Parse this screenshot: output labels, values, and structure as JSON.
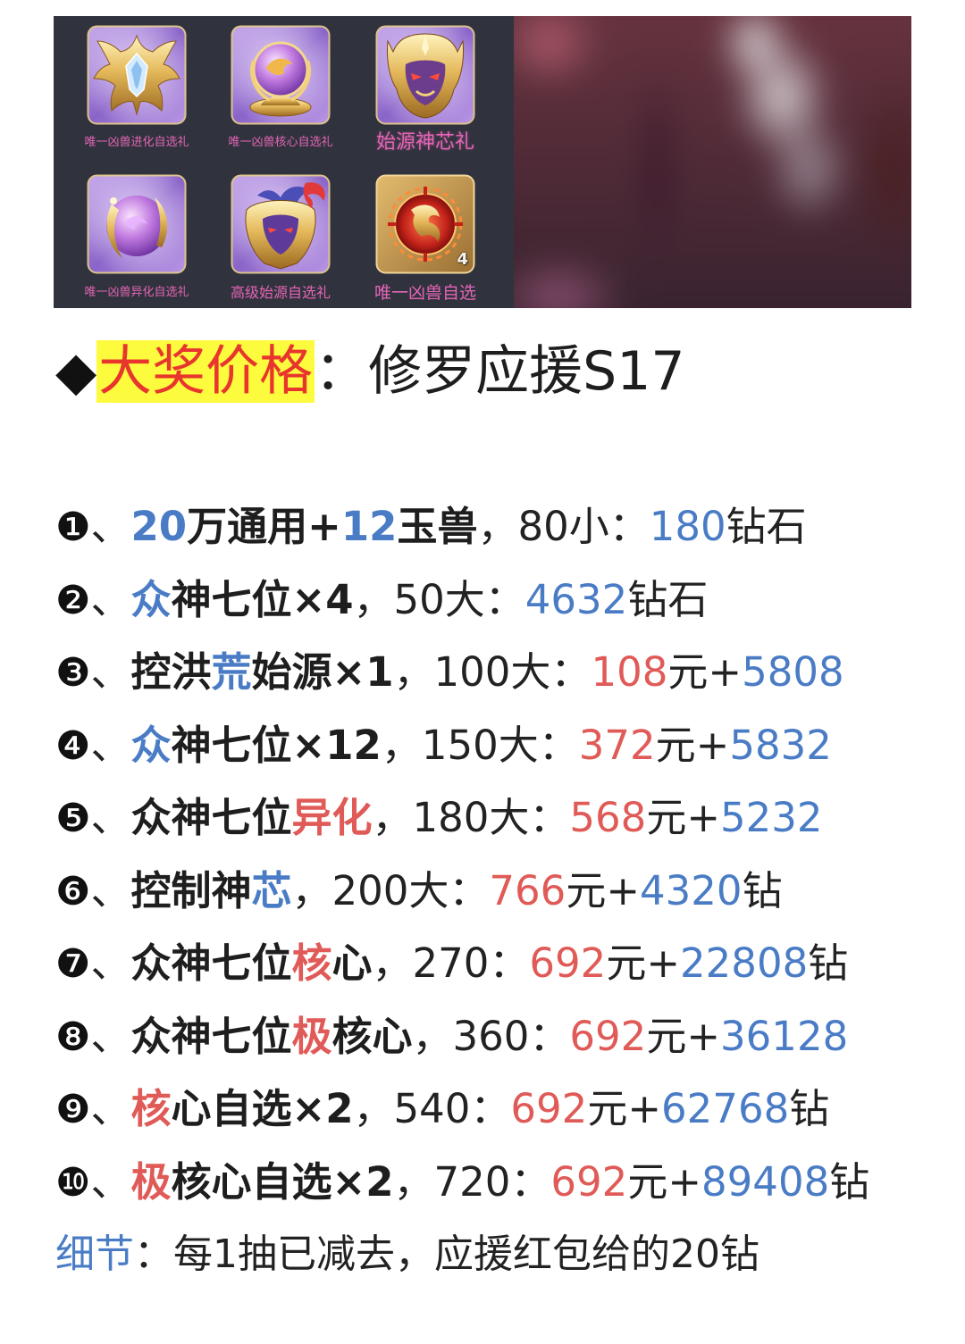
{
  "colors": {
    "blue": "#4a7cc6",
    "red": "#e05a57",
    "text": "#1e1e1e",
    "title_highlight_bg": "#fcfb3d",
    "title_highlight_text": "#e8352d",
    "item_label": "#e464b6",
    "item_panel_bg": "#30333d"
  },
  "hero": {
    "items": [
      {
        "label": "唯一凶兽进化自选礼",
        "icon": "winged-crest-icon"
      },
      {
        "label": "唯一凶兽核心自选礼",
        "icon": "golden-orb-icon"
      },
      {
        "label": "始源神芯礼",
        "icon": "demon-mask-icon"
      },
      {
        "label": "唯一凶兽异化自选礼",
        "icon": "purple-orb-icon"
      },
      {
        "label": "高级始源自选礼",
        "icon": "dragon-helmet-icon"
      },
      {
        "label": "唯一凶兽自选",
        "icon": "dragon-emblem-icon",
        "count": "4"
      }
    ]
  },
  "title": {
    "bullet": "◆",
    "highlight": "大奖价格",
    "rest": "：修罗应援S17"
  },
  "prizes": [
    {
      "num": "❶",
      "sep": "、",
      "name": [
        {
          "t": "20",
          "c": "blue"
        },
        {
          "t": "万通用+"
        },
        {
          "t": "12",
          "c": "blue"
        },
        {
          "t": "玉兽"
        }
      ],
      "draws": "，80小：",
      "price": [
        {
          "t": "180",
          "c": "blue"
        },
        {
          "t": "钻石"
        }
      ]
    },
    {
      "num": "❷",
      "sep": "、",
      "name": [
        {
          "t": "众",
          "c": "blue"
        },
        {
          "t": "神七位×4"
        }
      ],
      "draws": "，50大：",
      "price": [
        {
          "t": "4632",
          "c": "blue"
        },
        {
          "t": "钻石"
        }
      ]
    },
    {
      "num": "❸",
      "sep": "、",
      "name": [
        {
          "t": "控洪"
        },
        {
          "t": "荒",
          "c": "blue"
        },
        {
          "t": "始源×1"
        }
      ],
      "draws": "，100大：",
      "price": [
        {
          "t": "108",
          "c": "red"
        },
        {
          "t": "元+"
        },
        {
          "t": "5808",
          "c": "blue"
        }
      ]
    },
    {
      "num": "❹",
      "sep": "、",
      "name": [
        {
          "t": "众",
          "c": "blue"
        },
        {
          "t": "神七位×12"
        }
      ],
      "draws": "，150大：",
      "price": [
        {
          "t": "372",
          "c": "red"
        },
        {
          "t": "元+"
        },
        {
          "t": "5832",
          "c": "blue"
        }
      ]
    },
    {
      "num": "❺",
      "sep": "、",
      "name": [
        {
          "t": "众神七位"
        },
        {
          "t": "异化",
          "c": "red"
        }
      ],
      "draws": "，180大：",
      "price": [
        {
          "t": "568",
          "c": "red"
        },
        {
          "t": "元+"
        },
        {
          "t": "5232",
          "c": "blue"
        }
      ]
    },
    {
      "num": "❻",
      "sep": "、",
      "name": [
        {
          "t": "控制神"
        },
        {
          "t": "芯",
          "c": "blue"
        }
      ],
      "draws": "，200大：",
      "price": [
        {
          "t": "766",
          "c": "red"
        },
        {
          "t": "元+"
        },
        {
          "t": "4320",
          "c": "blue"
        },
        {
          "t": "钻"
        }
      ]
    },
    {
      "num": "❼",
      "sep": "、",
      "name": [
        {
          "t": "众神七位"
        },
        {
          "t": "核",
          "c": "red"
        },
        {
          "t": "心"
        }
      ],
      "draws": "，270：",
      "price": [
        {
          "t": "692",
          "c": "red"
        },
        {
          "t": "元+"
        },
        {
          "t": "22808",
          "c": "blue"
        },
        {
          "t": "钻"
        }
      ]
    },
    {
      "num": "❽",
      "sep": "、",
      "name": [
        {
          "t": "众神七位"
        },
        {
          "t": "极",
          "c": "red"
        },
        {
          "t": "核心"
        }
      ],
      "draws": "，360：",
      "price": [
        {
          "t": "692",
          "c": "red"
        },
        {
          "t": "元+"
        },
        {
          "t": "36128",
          "c": "blue"
        }
      ]
    },
    {
      "num": "❾",
      "sep": "、",
      "name": [
        {
          "t": "核",
          "c": "red"
        },
        {
          "t": "心自选×2"
        }
      ],
      "draws": "，540：",
      "price": [
        {
          "t": "692",
          "c": "red"
        },
        {
          "t": "元+"
        },
        {
          "t": "62768",
          "c": "blue"
        },
        {
          "t": "钻"
        }
      ]
    },
    {
      "num": "❿",
      "sep": "、",
      "name": [
        {
          "t": "极",
          "c": "red"
        },
        {
          "t": "核心自选×2"
        }
      ],
      "draws": "，720：",
      "price": [
        {
          "t": "692",
          "c": "red"
        },
        {
          "t": "元+"
        },
        {
          "t": "89408",
          "c": "blue"
        },
        {
          "t": "钻"
        }
      ]
    }
  ],
  "detail": {
    "label": "细节",
    "text": "：每1抽已减去，应援红包给的20钻"
  }
}
